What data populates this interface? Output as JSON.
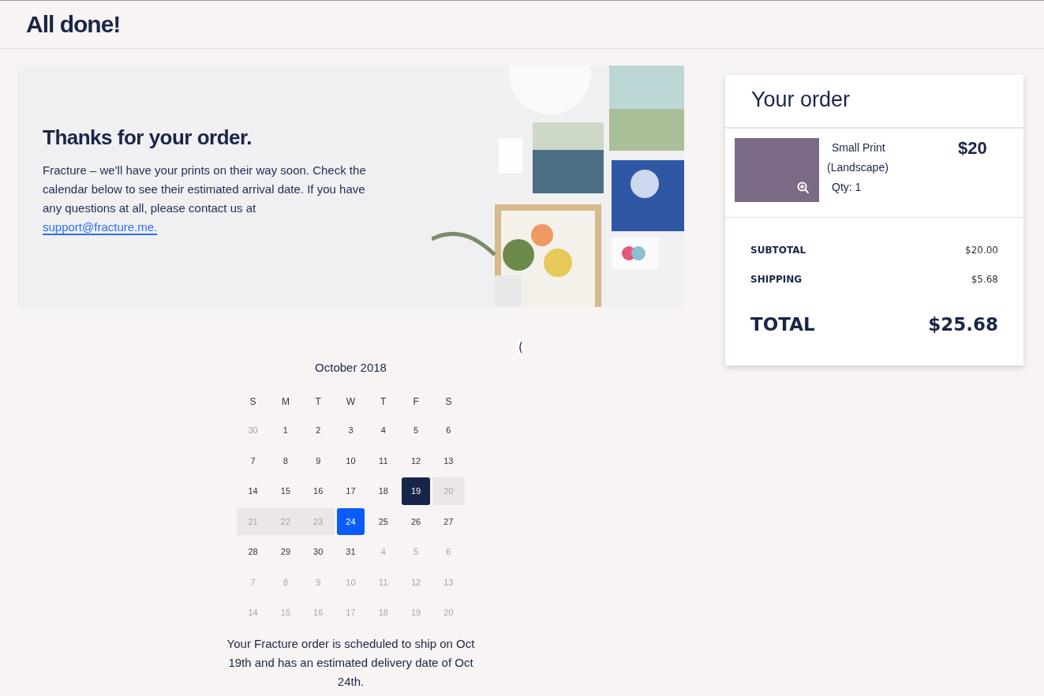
{
  "header": {
    "title": "All done!"
  },
  "banner": {
    "heading": "Thanks for your order.",
    "body": "Fracture – we'll have your prints on their way soon. Check the calendar below to see their estimated arrival date. If you have any questions at all, please contact us at",
    "link": "support@fracture.me."
  },
  "fragment": "(",
  "calendar": {
    "month": "October 2018",
    "weekdays": [
      "S",
      "M",
      "T",
      "W",
      "T",
      "F",
      "S"
    ],
    "weeks": [
      [
        {
          "day": "30",
          "kind": "outside"
        },
        {
          "day": "1",
          "kind": "normal"
        },
        {
          "day": "2",
          "kind": "normal"
        },
        {
          "day": "3",
          "kind": "normal"
        },
        {
          "day": "4",
          "kind": "normal"
        },
        {
          "day": "5",
          "kind": "normal"
        },
        {
          "day": "6",
          "kind": "normal"
        }
      ],
      [
        {
          "day": "7",
          "kind": "normal"
        },
        {
          "day": "8",
          "kind": "normal"
        },
        {
          "day": "9",
          "kind": "normal"
        },
        {
          "day": "10",
          "kind": "normal"
        },
        {
          "day": "11",
          "kind": "normal"
        },
        {
          "day": "12",
          "kind": "normal"
        },
        {
          "day": "13",
          "kind": "normal"
        }
      ],
      [
        {
          "day": "14",
          "kind": "normal"
        },
        {
          "day": "15",
          "kind": "normal"
        },
        {
          "day": "16",
          "kind": "normal"
        },
        {
          "day": "17",
          "kind": "normal"
        },
        {
          "day": "18",
          "kind": "normal"
        },
        {
          "day": "19",
          "kind": "ship"
        },
        {
          "day": "20",
          "kind": "range"
        }
      ],
      [
        {
          "day": "21",
          "kind": "range"
        },
        {
          "day": "22",
          "kind": "range"
        },
        {
          "day": "23",
          "kind": "range"
        },
        {
          "day": "24",
          "kind": "delivery"
        },
        {
          "day": "25",
          "kind": "normal"
        },
        {
          "day": "26",
          "kind": "normal"
        },
        {
          "day": "27",
          "kind": "normal"
        }
      ],
      [
        {
          "day": "28",
          "kind": "normal"
        },
        {
          "day": "29",
          "kind": "normal"
        },
        {
          "day": "30",
          "kind": "normal"
        },
        {
          "day": "31",
          "kind": "normal"
        },
        {
          "day": "4",
          "kind": "outside"
        },
        {
          "day": "5",
          "kind": "outside"
        },
        {
          "day": "6",
          "kind": "outside"
        }
      ],
      [
        {
          "day": "7",
          "kind": "outside"
        },
        {
          "day": "8",
          "kind": "outside"
        },
        {
          "day": "9",
          "kind": "outside"
        },
        {
          "day": "10",
          "kind": "outside"
        },
        {
          "day": "11",
          "kind": "outside"
        },
        {
          "day": "12",
          "kind": "outside"
        },
        {
          "day": "13",
          "kind": "outside"
        }
      ],
      [
        {
          "day": "14",
          "kind": "outside"
        },
        {
          "day": "15",
          "kind": "outside"
        },
        {
          "day": "16",
          "kind": "outside"
        },
        {
          "day": "17",
          "kind": "outside"
        },
        {
          "day": "18",
          "kind": "outside"
        },
        {
          "day": "19",
          "kind": "outside"
        },
        {
          "day": "20",
          "kind": "outside"
        }
      ]
    ],
    "note": "Your Fracture order is scheduled to ship on Oct 19th and has an estimated delivery date of Oct 24th."
  },
  "order": {
    "title": "Your order",
    "item": {
      "name": "Small Print",
      "variant": "(Landscape)",
      "qty": "Qty: 1",
      "price": "$20"
    },
    "lines": [
      {
        "label": "SUBTOTAL",
        "value": "$20.00"
      },
      {
        "label": "SHIPPING",
        "value": "$5.68"
      }
    ],
    "total": {
      "label": "TOTAL",
      "value": "$25.68"
    }
  }
}
